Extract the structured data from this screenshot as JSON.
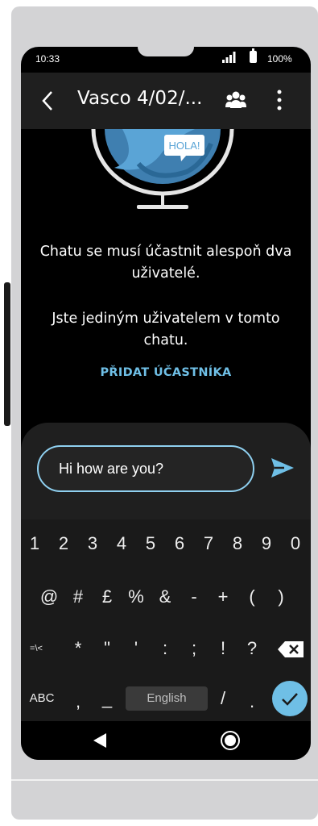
{
  "status_bar": {
    "time": "10:33",
    "battery": "100%"
  },
  "app_bar": {
    "title": "Vasco 4/02/..."
  },
  "illustration": {
    "bubble_text": "HOLA!"
  },
  "empty_state": {
    "line1": "Chatu se musí účastnit alespoň dva uživatelé.",
    "line2": "Jste jediným uživatelem v tomto chatu.",
    "action": "PŘIDAT ÚČASTNÍKA"
  },
  "compose": {
    "value": "Hi how are you?"
  },
  "keyboard": {
    "row1": [
      "1",
      "2",
      "3",
      "4",
      "5",
      "6",
      "7",
      "8",
      "9",
      "0"
    ],
    "row2": [
      "@",
      "#",
      "£",
      "%",
      "&",
      "-",
      "+",
      "(",
      ")"
    ],
    "row3": [
      "=\\<",
      "*",
      "\"",
      "'",
      ":",
      ";",
      "!",
      "?"
    ],
    "row4_left": [
      "ABC",
      ",",
      "_"
    ],
    "space": "English",
    "row4_right": [
      "/",
      "."
    ]
  },
  "colors": {
    "accent": "#6fbfe6",
    "app_bar": "#1f1f1f",
    "background": "#000000"
  },
  "icons": [
    "back-icon",
    "people-icon",
    "more-vertical-icon",
    "send-icon",
    "backspace-icon",
    "check-icon"
  ]
}
